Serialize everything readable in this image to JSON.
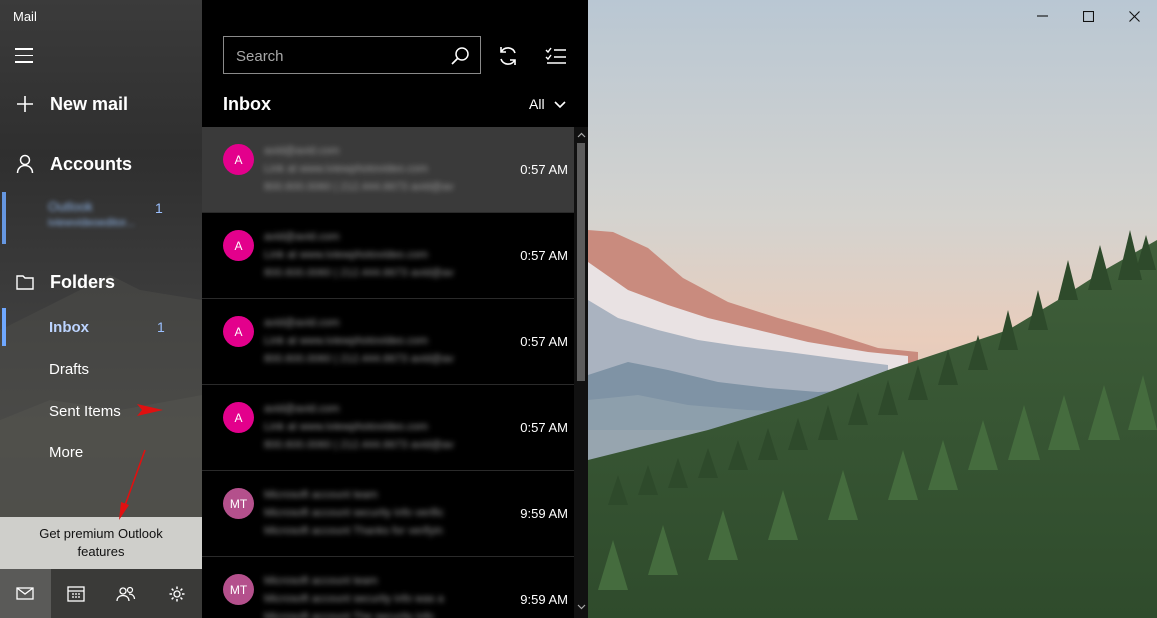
{
  "app": {
    "title": "Mail"
  },
  "nav": {
    "new_mail": "New mail",
    "accounts_heading": "Accounts",
    "account": {
      "name": "Outlook",
      "email": "iviewvideoeditor...",
      "unread": "1"
    },
    "folders_heading": "Folders",
    "folders": [
      {
        "label": "Inbox",
        "count": "1",
        "selected": true
      },
      {
        "label": "Drafts",
        "count": ""
      },
      {
        "label": "Sent Items",
        "count": ""
      },
      {
        "label": "More",
        "count": ""
      }
    ],
    "promo": "Get premium Outlook features",
    "bottom_icons": [
      "mail-icon",
      "calendar-icon",
      "people-icon",
      "settings-icon"
    ]
  },
  "list": {
    "search_placeholder": "Search",
    "heading": "Inbox",
    "filter": "All",
    "messages": [
      {
        "initials": "A",
        "avatar_color": "#e3008c",
        "sender": "avid@avid.com",
        "subject": "Link at www.iviewphotovideo.com",
        "preview": "800.600.0060 | 212.444.6673 avid@av",
        "time": "0:57 AM",
        "selected": true
      },
      {
        "initials": "A",
        "avatar_color": "#e3008c",
        "sender": "avid@avid.com",
        "subject": "Link at www.iviewphotovideo.com",
        "preview": "800.600.0060 | 212.444.6673 avid@av",
        "time": "0:57 AM",
        "selected": false
      },
      {
        "initials": "A",
        "avatar_color": "#e3008c",
        "sender": "avid@avid.com",
        "subject": "Link at www.iviewphotovideo.com",
        "preview": "800.600.0060 | 212.444.6673 avid@av",
        "time": "0:57 AM",
        "selected": false
      },
      {
        "initials": "A",
        "avatar_color": "#e3008c",
        "sender": "avid@avid.com",
        "subject": "Link at www.iviewphotovideo.com",
        "preview": "800.600.0060 | 212.444.6673 avid@av",
        "time": "0:57 AM",
        "selected": false
      },
      {
        "initials": "MT",
        "avatar_color": "#b4508c",
        "sender": "Microsoft account team",
        "subject": "Microsoft account security info verific",
        "preview": "Microsoft account Thanks for verifyin",
        "time": "9:59 AM",
        "selected": false
      },
      {
        "initials": "MT",
        "avatar_color": "#b4508c",
        "sender": "Microsoft account team",
        "subject": "Microsoft account security info was a",
        "preview": "Microsoft account The security info",
        "time": "9:59 AM",
        "selected": false
      }
    ]
  },
  "colors": {
    "accent": "#6fa8ff",
    "annotation_arrow": "#e01010"
  }
}
